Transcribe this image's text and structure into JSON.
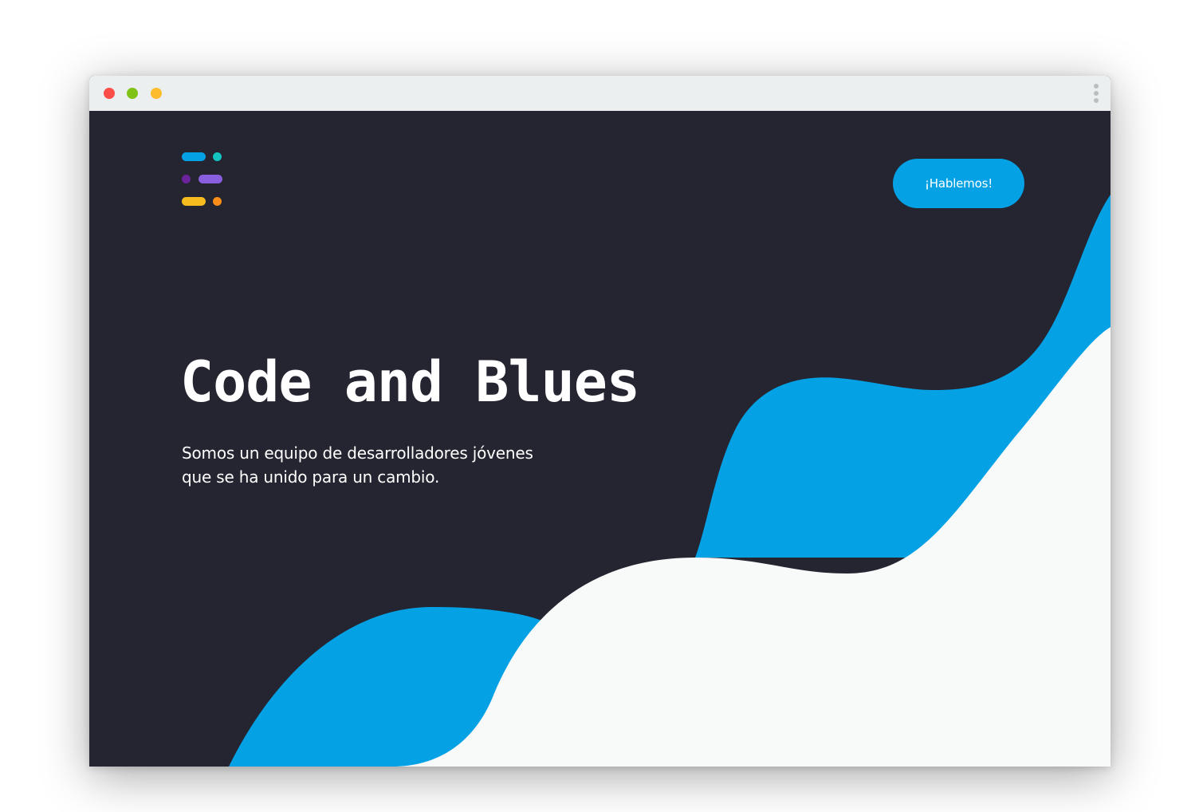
{
  "browser": {
    "controls": [
      "close",
      "minimize",
      "maximize"
    ],
    "menu_icon": "kebab-menu-icon"
  },
  "header": {
    "logo_icon": "code-and-blues-logo-icon",
    "cta_label": "¡Hablemos!"
  },
  "hero": {
    "title": "Code and Blues",
    "subtitle_line1": "Somos un equipo de desarrolladores jóvenes",
    "subtitle_line2": "que se ha unido para un cambio."
  },
  "colors": {
    "background": "#242530",
    "accent_blue": "#04a1e5",
    "wave_light": "#f8f9f9",
    "titlebar": "#eceff0",
    "logo_bars": [
      "#04a1e5",
      "#13c4c0",
      "#6b239c",
      "#8a5fdf",
      "#f6bc1f",
      "#fb8d18"
    ]
  }
}
